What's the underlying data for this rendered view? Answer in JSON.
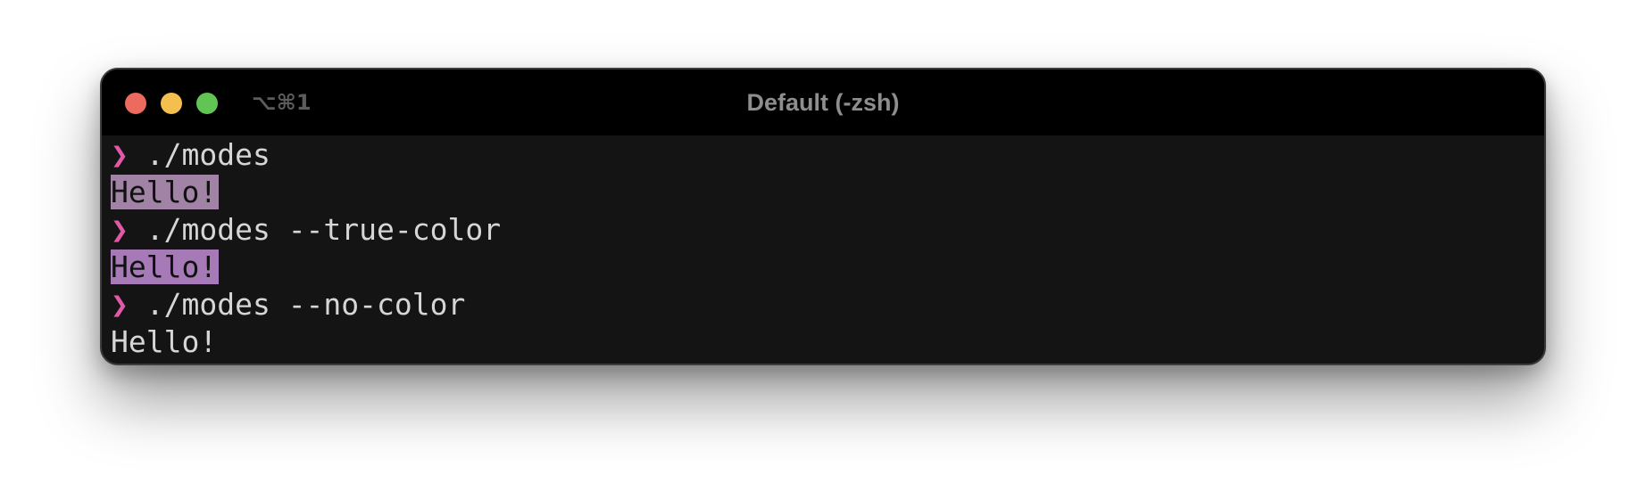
{
  "window": {
    "shortcut": "⌥⌘1",
    "title": "Default (-zsh)"
  },
  "terminal": {
    "prompt_symbol": "❯",
    "lines": [
      {
        "kind": "command",
        "text": "./modes"
      },
      {
        "kind": "output",
        "text": "Hello!",
        "background": "#a183a6"
      },
      {
        "kind": "command",
        "text": "./modes --true-color"
      },
      {
        "kind": "output",
        "text": "Hello!",
        "background": "#a67ab6"
      },
      {
        "kind": "command",
        "text": "./modes --no-color"
      },
      {
        "kind": "output",
        "text": "Hello!",
        "background": null
      }
    ]
  },
  "colors": {
    "prompt": "#e059a6",
    "text": "#d6d6d6",
    "traffic_red": "#ed6a5e",
    "traffic_yellow": "#f4bf4f",
    "traffic_green": "#61c554"
  }
}
